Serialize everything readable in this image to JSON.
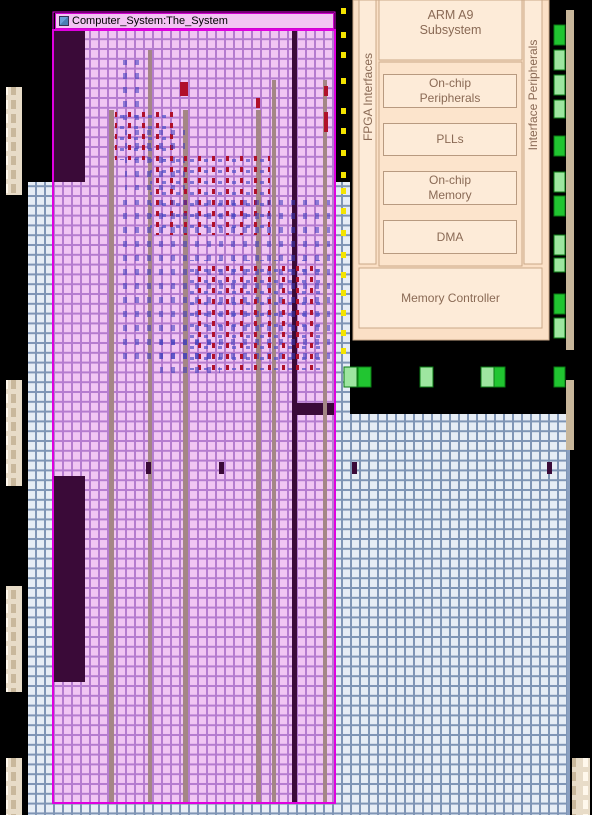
{
  "region": {
    "name": "Computer_System:The_System",
    "icon": "region-icon"
  },
  "hps": {
    "subsystem": "ARM A9\nSubsystem",
    "blocks": [
      "On-chip\nPeripherals",
      "PLLs",
      "On-chip\nMemory",
      "DMA"
    ],
    "memory_controller": "Memory Controller",
    "fpga_interfaces": "FPGA Interfaces",
    "interface_peripherals": "Interface Peripherals"
  },
  "colors": {
    "background": "#000000",
    "logic_cell": "#dfe7f0",
    "region_fill": "#e9b9ef",
    "region_border": "#e000e0",
    "hps_fill": "#fbe0c6",
    "io_green": "#22cc33"
  }
}
